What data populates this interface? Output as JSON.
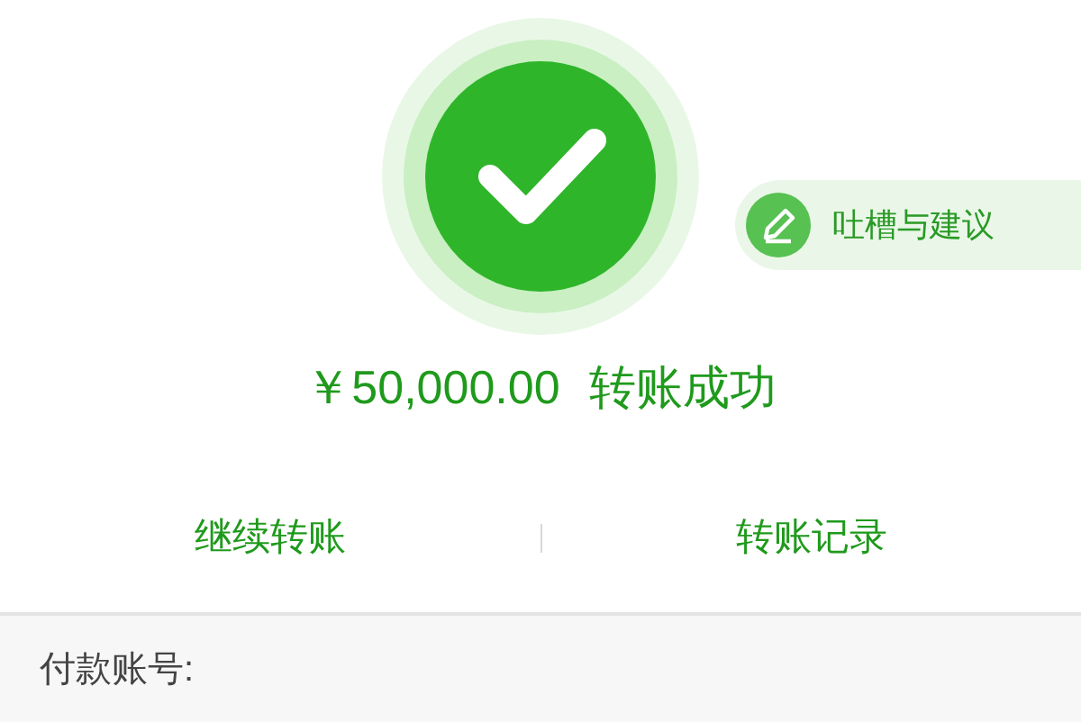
{
  "feedback_button": {
    "label": "吐槽与建议"
  },
  "result": {
    "amount": "￥50,000.00",
    "status": "转账成功"
  },
  "actions": [
    "继续转账",
    "转账记录"
  ],
  "payment_account": {
    "label": "付款账号:"
  }
}
